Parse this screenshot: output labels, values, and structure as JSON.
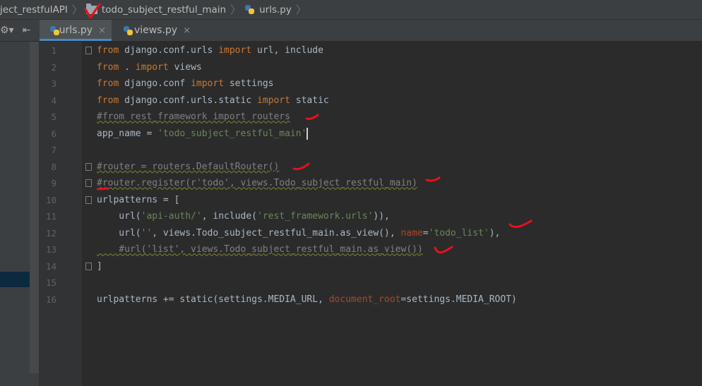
{
  "breadcrumb": {
    "items": [
      {
        "label": "ject_restfulAPI",
        "icon": "none"
      },
      {
        "label": "todo_subject_restful_main",
        "icon": "folder-icon"
      },
      {
        "label": "urls.py",
        "icon": "python-file-icon"
      }
    ]
  },
  "toolbar": {
    "settings_glyph": "⚙▾",
    "collapse_glyph": "⇤"
  },
  "tabs": [
    {
      "label": "urls.py",
      "close": "×",
      "active": true
    },
    {
      "label": "views.py",
      "close": "×",
      "active": false
    }
  ],
  "editor": {
    "lines": [
      {
        "n": "1",
        "tokens": [
          [
            "kw",
            "from"
          ],
          [
            "p",
            " django.conf.urls "
          ],
          [
            "kw",
            "import"
          ],
          [
            "p",
            " url, include"
          ]
        ]
      },
      {
        "n": "2",
        "tokens": [
          [
            "kw",
            "from"
          ],
          [
            "p",
            " . "
          ],
          [
            "kw",
            "import"
          ],
          [
            "p",
            " views"
          ]
        ]
      },
      {
        "n": "3",
        "tokens": [
          [
            "kw",
            "from"
          ],
          [
            "p",
            " django.conf "
          ],
          [
            "kw",
            "import"
          ],
          [
            "p",
            " settings"
          ]
        ]
      },
      {
        "n": "4",
        "tokens": [
          [
            "kw",
            "from"
          ],
          [
            "p",
            " django.conf.urls.static "
          ],
          [
            "kw",
            "import"
          ],
          [
            "p",
            " static"
          ]
        ]
      },
      {
        "n": "5",
        "tokens": [
          [
            "com",
            "#from rest_framework import routers"
          ]
        ]
      },
      {
        "n": "6",
        "tokens": [
          [
            "p",
            "app_name = "
          ],
          [
            "str",
            "'todo_subject_restful_main'"
          ]
        ]
      },
      {
        "n": "7",
        "tokens": []
      },
      {
        "n": "8",
        "tokens": [
          [
            "com",
            "#router = routers.DefaultRouter()"
          ]
        ]
      },
      {
        "n": "9",
        "tokens": [
          [
            "com",
            "#router.register(r'todo', views.Todo_subject_restful_main)"
          ]
        ]
      },
      {
        "n": "10",
        "tokens": [
          [
            "p",
            "urlpatterns = ["
          ]
        ]
      },
      {
        "n": "11",
        "tokens": [
          [
            "p",
            "    url("
          ],
          [
            "str",
            "'api-auth/'"
          ],
          [
            "p",
            ", include("
          ],
          [
            "str",
            "'rest_framework.urls'"
          ],
          [
            "p",
            ")),"
          ]
        ]
      },
      {
        "n": "12",
        "tokens": [
          [
            "p",
            "    url("
          ],
          [
            "str",
            "''"
          ],
          [
            "p",
            ", views.Todo_subject_restful_main.as_view(), "
          ],
          [
            "param",
            "name"
          ],
          [
            "p",
            "="
          ],
          [
            "str",
            "'todo_list'"
          ],
          [
            "p",
            "),"
          ]
        ]
      },
      {
        "n": "13",
        "tokens": [
          [
            "com",
            "    #url('list', views.Todo_subject_restful_main.as_view())"
          ]
        ]
      },
      {
        "n": "14",
        "tokens": [
          [
            "p",
            "]"
          ]
        ]
      },
      {
        "n": "15",
        "tokens": []
      },
      {
        "n": "16",
        "tokens": [
          [
            "p",
            "urlpatterns += static(settings.MEDIA_URL, "
          ],
          [
            "param",
            "document_root"
          ],
          [
            "p",
            "=settings.MEDIA_ROOT)"
          ]
        ]
      }
    ]
  },
  "colors": {
    "keyword": "#cc7832",
    "string": "#6a8759",
    "comment": "#808080",
    "param": "#aa4926",
    "annotation": "#e8101a"
  }
}
